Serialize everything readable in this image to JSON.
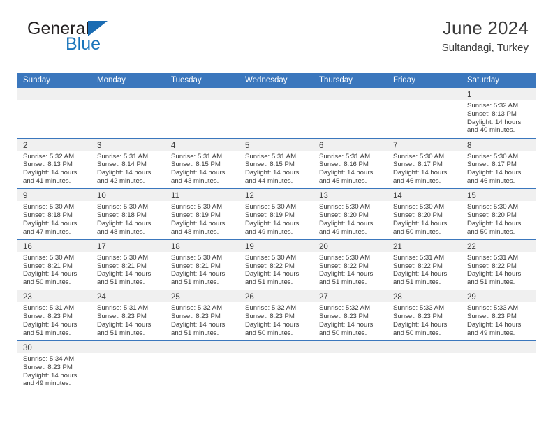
{
  "brand": {
    "name_top": "General",
    "name_bottom": "Blue",
    "triangle_icon": "triangle-icon",
    "color_dark": "#231f20",
    "color_blue": "#1b75bb"
  },
  "header": {
    "title": "June 2024",
    "subtitle": "Sultandagi, Turkey"
  },
  "theme": {
    "header_bar": "#3b77bd",
    "daynum_band": "#f0f0f0",
    "text": "#3a3a3a"
  },
  "calendar": {
    "weekday_headers": [
      "Sunday",
      "Monday",
      "Tuesday",
      "Wednesday",
      "Thursday",
      "Friday",
      "Saturday"
    ],
    "weeks": [
      [
        {
          "day": "",
          "empty": true,
          "sunrise": "",
          "sunset": "",
          "daylight1": "",
          "daylight2": ""
        },
        {
          "day": "",
          "empty": true,
          "sunrise": "",
          "sunset": "",
          "daylight1": "",
          "daylight2": ""
        },
        {
          "day": "",
          "empty": true,
          "sunrise": "",
          "sunset": "",
          "daylight1": "",
          "daylight2": ""
        },
        {
          "day": "",
          "empty": true,
          "sunrise": "",
          "sunset": "",
          "daylight1": "",
          "daylight2": ""
        },
        {
          "day": "",
          "empty": true,
          "sunrise": "",
          "sunset": "",
          "daylight1": "",
          "daylight2": ""
        },
        {
          "day": "",
          "empty": true,
          "sunrise": "",
          "sunset": "",
          "daylight1": "",
          "daylight2": ""
        },
        {
          "day": "1",
          "empty": false,
          "sunrise": "Sunrise: 5:32 AM",
          "sunset": "Sunset: 8:13 PM",
          "daylight1": "Daylight: 14 hours",
          "daylight2": "and 40 minutes."
        }
      ],
      [
        {
          "day": "2",
          "empty": false,
          "sunrise": "Sunrise: 5:32 AM",
          "sunset": "Sunset: 8:13 PM",
          "daylight1": "Daylight: 14 hours",
          "daylight2": "and 41 minutes."
        },
        {
          "day": "3",
          "empty": false,
          "sunrise": "Sunrise: 5:31 AM",
          "sunset": "Sunset: 8:14 PM",
          "daylight1": "Daylight: 14 hours",
          "daylight2": "and 42 minutes."
        },
        {
          "day": "4",
          "empty": false,
          "sunrise": "Sunrise: 5:31 AM",
          "sunset": "Sunset: 8:15 PM",
          "daylight1": "Daylight: 14 hours",
          "daylight2": "and 43 minutes."
        },
        {
          "day": "5",
          "empty": false,
          "sunrise": "Sunrise: 5:31 AM",
          "sunset": "Sunset: 8:15 PM",
          "daylight1": "Daylight: 14 hours",
          "daylight2": "and 44 minutes."
        },
        {
          "day": "6",
          "empty": false,
          "sunrise": "Sunrise: 5:31 AM",
          "sunset": "Sunset: 8:16 PM",
          "daylight1": "Daylight: 14 hours",
          "daylight2": "and 45 minutes."
        },
        {
          "day": "7",
          "empty": false,
          "sunrise": "Sunrise: 5:30 AM",
          "sunset": "Sunset: 8:17 PM",
          "daylight1": "Daylight: 14 hours",
          "daylight2": "and 46 minutes."
        },
        {
          "day": "8",
          "empty": false,
          "sunrise": "Sunrise: 5:30 AM",
          "sunset": "Sunset: 8:17 PM",
          "daylight1": "Daylight: 14 hours",
          "daylight2": "and 46 minutes."
        }
      ],
      [
        {
          "day": "9",
          "empty": false,
          "sunrise": "Sunrise: 5:30 AM",
          "sunset": "Sunset: 8:18 PM",
          "daylight1": "Daylight: 14 hours",
          "daylight2": "and 47 minutes."
        },
        {
          "day": "10",
          "empty": false,
          "sunrise": "Sunrise: 5:30 AM",
          "sunset": "Sunset: 8:18 PM",
          "daylight1": "Daylight: 14 hours",
          "daylight2": "and 48 minutes."
        },
        {
          "day": "11",
          "empty": false,
          "sunrise": "Sunrise: 5:30 AM",
          "sunset": "Sunset: 8:19 PM",
          "daylight1": "Daylight: 14 hours",
          "daylight2": "and 48 minutes."
        },
        {
          "day": "12",
          "empty": false,
          "sunrise": "Sunrise: 5:30 AM",
          "sunset": "Sunset: 8:19 PM",
          "daylight1": "Daylight: 14 hours",
          "daylight2": "and 49 minutes."
        },
        {
          "day": "13",
          "empty": false,
          "sunrise": "Sunrise: 5:30 AM",
          "sunset": "Sunset: 8:20 PM",
          "daylight1": "Daylight: 14 hours",
          "daylight2": "and 49 minutes."
        },
        {
          "day": "14",
          "empty": false,
          "sunrise": "Sunrise: 5:30 AM",
          "sunset": "Sunset: 8:20 PM",
          "daylight1": "Daylight: 14 hours",
          "daylight2": "and 50 minutes."
        },
        {
          "day": "15",
          "empty": false,
          "sunrise": "Sunrise: 5:30 AM",
          "sunset": "Sunset: 8:20 PM",
          "daylight1": "Daylight: 14 hours",
          "daylight2": "and 50 minutes."
        }
      ],
      [
        {
          "day": "16",
          "empty": false,
          "sunrise": "Sunrise: 5:30 AM",
          "sunset": "Sunset: 8:21 PM",
          "daylight1": "Daylight: 14 hours",
          "daylight2": "and 50 minutes."
        },
        {
          "day": "17",
          "empty": false,
          "sunrise": "Sunrise: 5:30 AM",
          "sunset": "Sunset: 8:21 PM",
          "daylight1": "Daylight: 14 hours",
          "daylight2": "and 51 minutes."
        },
        {
          "day": "18",
          "empty": false,
          "sunrise": "Sunrise: 5:30 AM",
          "sunset": "Sunset: 8:21 PM",
          "daylight1": "Daylight: 14 hours",
          "daylight2": "and 51 minutes."
        },
        {
          "day": "19",
          "empty": false,
          "sunrise": "Sunrise: 5:30 AM",
          "sunset": "Sunset: 8:22 PM",
          "daylight1": "Daylight: 14 hours",
          "daylight2": "and 51 minutes."
        },
        {
          "day": "20",
          "empty": false,
          "sunrise": "Sunrise: 5:30 AM",
          "sunset": "Sunset: 8:22 PM",
          "daylight1": "Daylight: 14 hours",
          "daylight2": "and 51 minutes."
        },
        {
          "day": "21",
          "empty": false,
          "sunrise": "Sunrise: 5:31 AM",
          "sunset": "Sunset: 8:22 PM",
          "daylight1": "Daylight: 14 hours",
          "daylight2": "and 51 minutes."
        },
        {
          "day": "22",
          "empty": false,
          "sunrise": "Sunrise: 5:31 AM",
          "sunset": "Sunset: 8:22 PM",
          "daylight1": "Daylight: 14 hours",
          "daylight2": "and 51 minutes."
        }
      ],
      [
        {
          "day": "23",
          "empty": false,
          "sunrise": "Sunrise: 5:31 AM",
          "sunset": "Sunset: 8:23 PM",
          "daylight1": "Daylight: 14 hours",
          "daylight2": "and 51 minutes."
        },
        {
          "day": "24",
          "empty": false,
          "sunrise": "Sunrise: 5:31 AM",
          "sunset": "Sunset: 8:23 PM",
          "daylight1": "Daylight: 14 hours",
          "daylight2": "and 51 minutes."
        },
        {
          "day": "25",
          "empty": false,
          "sunrise": "Sunrise: 5:32 AM",
          "sunset": "Sunset: 8:23 PM",
          "daylight1": "Daylight: 14 hours",
          "daylight2": "and 51 minutes."
        },
        {
          "day": "26",
          "empty": false,
          "sunrise": "Sunrise: 5:32 AM",
          "sunset": "Sunset: 8:23 PM",
          "daylight1": "Daylight: 14 hours",
          "daylight2": "and 50 minutes."
        },
        {
          "day": "27",
          "empty": false,
          "sunrise": "Sunrise: 5:32 AM",
          "sunset": "Sunset: 8:23 PM",
          "daylight1": "Daylight: 14 hours",
          "daylight2": "and 50 minutes."
        },
        {
          "day": "28",
          "empty": false,
          "sunrise": "Sunrise: 5:33 AM",
          "sunset": "Sunset: 8:23 PM",
          "daylight1": "Daylight: 14 hours",
          "daylight2": "and 50 minutes."
        },
        {
          "day": "29",
          "empty": false,
          "sunrise": "Sunrise: 5:33 AM",
          "sunset": "Sunset: 8:23 PM",
          "daylight1": "Daylight: 14 hours",
          "daylight2": "and 49 minutes."
        }
      ],
      [
        {
          "day": "30",
          "empty": false,
          "sunrise": "Sunrise: 5:34 AM",
          "sunset": "Sunset: 8:23 PM",
          "daylight1": "Daylight: 14 hours",
          "daylight2": "and 49 minutes."
        },
        {
          "day": "",
          "empty": true,
          "sunrise": "",
          "sunset": "",
          "daylight1": "",
          "daylight2": ""
        },
        {
          "day": "",
          "empty": true,
          "sunrise": "",
          "sunset": "",
          "daylight1": "",
          "daylight2": ""
        },
        {
          "day": "",
          "empty": true,
          "sunrise": "",
          "sunset": "",
          "daylight1": "",
          "daylight2": ""
        },
        {
          "day": "",
          "empty": true,
          "sunrise": "",
          "sunset": "",
          "daylight1": "",
          "daylight2": ""
        },
        {
          "day": "",
          "empty": true,
          "sunrise": "",
          "sunset": "",
          "daylight1": "",
          "daylight2": ""
        },
        {
          "day": "",
          "empty": true,
          "sunrise": "",
          "sunset": "",
          "daylight1": "",
          "daylight2": ""
        }
      ]
    ]
  }
}
